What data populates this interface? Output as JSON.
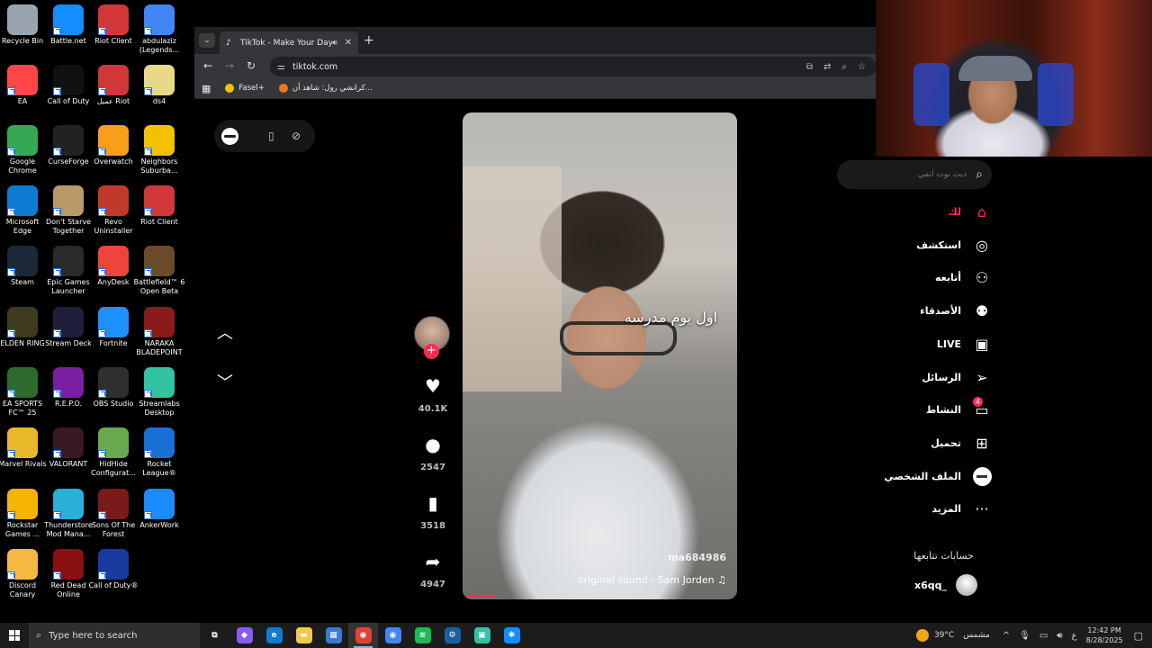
{
  "desktop": {
    "icons": [
      {
        "label": "Recycle Bin",
        "icon": "recycle-bin-icon",
        "color": "#9aa4ae"
      },
      {
        "label": "Battle.net",
        "icon": "battlenet-icon",
        "color": "#148eff"
      },
      {
        "label": "Riot Client",
        "icon": "riot-client-icon",
        "color": "#d13639"
      },
      {
        "label": "abdulaziz (Legends...",
        "icon": "chrome-profile-icon",
        "color": "#4285f4"
      },
      {
        "label": "EA",
        "icon": "ea-icon",
        "color": "#ff4747"
      },
      {
        "label": "Call of Duty",
        "icon": "call-of-duty-icon",
        "color": "#111111"
      },
      {
        "label": "عميل Riot",
        "icon": "riot-client-icon",
        "color": "#d13639"
      },
      {
        "label": "ds4",
        "icon": "folder-file-icon",
        "color": "#e8d98a"
      },
      {
        "label": "Google Chrome",
        "icon": "chrome-icon",
        "color": "#34a853"
      },
      {
        "label": "CurseForge",
        "icon": "curseforge-icon",
        "color": "#222222"
      },
      {
        "label": "Overwatch",
        "icon": "overwatch-icon",
        "color": "#f99e1a"
      },
      {
        "label": "Neighbors Suburba...",
        "icon": "neighbors-icon",
        "color": "#f2c200"
      },
      {
        "label": "Microsoft Edge",
        "icon": "edge-icon",
        "color": "#0c7bd1"
      },
      {
        "label": "Don't Starve Together",
        "icon": "dont-starve-icon",
        "color": "#b89a6a"
      },
      {
        "label": "Revo Uninstaller",
        "icon": "revo-icon",
        "color": "#c0392b"
      },
      {
        "label": "Riot Client",
        "icon": "riot-client-icon",
        "color": "#d13639"
      },
      {
        "label": "Steam",
        "icon": "steam-icon",
        "color": "#1b2838"
      },
      {
        "label": "Epic Games Launcher",
        "icon": "epic-games-icon",
        "color": "#2a2a2a"
      },
      {
        "label": "AnyDesk",
        "icon": "anydesk-icon",
        "color": "#ef443b"
      },
      {
        "label": "Battlefield™ 6 Open Beta",
        "icon": "battlefield-icon",
        "color": "#6b4a2a"
      },
      {
        "label": "ELDEN RING",
        "icon": "elden-ring-icon",
        "color": "#3d3a1e"
      },
      {
        "label": "Stream Deck",
        "icon": "stream-deck-icon",
        "color": "#1f1f3a"
      },
      {
        "label": "Fortnite",
        "icon": "fortnite-icon",
        "color": "#1e90ff"
      },
      {
        "label": "NARAKA BLADEPOINT",
        "icon": "naraka-icon",
        "color": "#8b1a1a"
      },
      {
        "label": "EA SPORTS FC™ 25",
        "icon": "ea-fc-icon",
        "color": "#2d6b2d"
      },
      {
        "label": "R.E.P.O.",
        "icon": "repo-icon",
        "color": "#7a1fa2"
      },
      {
        "label": "OBS Studio",
        "icon": "obs-icon",
        "color": "#302e31"
      },
      {
        "label": "Streamlabs Desktop",
        "icon": "streamlabs-icon",
        "color": "#31c3a2"
      },
      {
        "label": "Marvel Rivals",
        "icon": "marvel-rivals-icon",
        "color": "#e8b82a"
      },
      {
        "label": "VALORANT",
        "icon": "valorant-icon",
        "color": "#3a1a22"
      },
      {
        "label": "HidHide Configurat...",
        "icon": "hidhide-icon",
        "color": "#6aa84f"
      },
      {
        "label": "Rocket League®",
        "icon": "rocket-league-icon",
        "color": "#1a6fd6"
      },
      {
        "label": "Rockstar Games ...",
        "icon": "rockstar-icon",
        "color": "#f4b400"
      },
      {
        "label": "Thunderstore Mod Mana...",
        "icon": "thunderstore-icon",
        "color": "#2ab0d6"
      },
      {
        "label": "Sons Of The Forest",
        "icon": "sons-forest-icon",
        "color": "#7a1a1a"
      },
      {
        "label": "AnkerWork",
        "icon": "ankerwork-icon",
        "color": "#1a8cff"
      },
      {
        "label": "Discord Canary",
        "icon": "discord-canary-icon",
        "color": "#f5b942"
      },
      {
        "label": "Red Dead Online",
        "icon": "red-dead-icon",
        "color": "#8b1010"
      },
      {
        "label": "Call of Duty®",
        "icon": "call-of-duty-icon",
        "color": "#1a3aa0"
      }
    ]
  },
  "browser": {
    "tab_title": "TikTok - Make Your Day",
    "new_tab_glyph": "+",
    "url": "tiktok.com",
    "bookmarks": [
      {
        "label": "Fasel+",
        "color": "#f2c200"
      },
      {
        "label": "كرانشي رول: شاهد أن...",
        "color": "#f47521"
      }
    ]
  },
  "tiktok": {
    "video": {
      "overlay_text": "اول يوم مدرسه",
      "username": "ma684986",
      "sound": "original sound - Sam Jorden ♫",
      "progress": 0.1
    },
    "actions": [
      {
        "name": "like",
        "glyph": "♥",
        "count": "40.1K"
      },
      {
        "name": "comment",
        "glyph": "●",
        "count": "2547"
      },
      {
        "name": "save",
        "glyph": "▮",
        "count": "3518"
      },
      {
        "name": "share",
        "glyph": "➦",
        "count": "4947"
      }
    ],
    "search_placeholder": "ديث نوت انمي",
    "nav": [
      {
        "label": "لك",
        "icon": "home-icon",
        "glyph": "⌂",
        "active": true
      },
      {
        "label": "استكشف",
        "icon": "compass-icon",
        "glyph": "◎"
      },
      {
        "label": "أتابعه",
        "icon": "user-plus-icon",
        "glyph": "⚇"
      },
      {
        "label": "الأصدقاء",
        "icon": "friends-icon",
        "glyph": "⚉"
      },
      {
        "label": "LIVE",
        "icon": "live-tv-icon",
        "glyph": "▣"
      },
      {
        "label": "الرسائل",
        "icon": "send-icon",
        "glyph": "➢"
      },
      {
        "label": "النشاط",
        "icon": "activity-icon",
        "glyph": "▭",
        "badge": "4"
      },
      {
        "label": "تحميل",
        "icon": "upload-icon",
        "glyph": "⊞"
      },
      {
        "label": "الملف الشخصي",
        "icon": "profile-avatar-icon",
        "glyph": ""
      },
      {
        "label": "المزيد",
        "icon": "more-icon",
        "glyph": "···"
      }
    ],
    "following_title": "حسابات تتابعها",
    "following": [
      {
        "name": "x6qq_"
      }
    ]
  },
  "taskbar": {
    "search_placeholder": "Type here to search",
    "apps": [
      {
        "icon": "task-view-icon",
        "glyph": "⧉",
        "color": "#1c1c1c"
      },
      {
        "icon": "copilot-icon",
        "glyph": "◆",
        "color": "#8a5cf6"
      },
      {
        "icon": "edge-icon",
        "glyph": "e",
        "color": "#0c7bd1"
      },
      {
        "icon": "file-explorer-icon",
        "glyph": "▬",
        "color": "#f2c94c"
      },
      {
        "icon": "store-icon",
        "glyph": "▦",
        "color": "#3a7bd5"
      },
      {
        "icon": "chrome-icon",
        "glyph": "◉",
        "color": "#db4437",
        "active": true
      },
      {
        "icon": "chrome-profile-icon",
        "glyph": "◉",
        "color": "#4285f4"
      },
      {
        "icon": "spotify-icon",
        "glyph": "≋",
        "color": "#1db954"
      },
      {
        "icon": "steam-icon",
        "glyph": "⚙",
        "color": "#1b5f9e"
      },
      {
        "icon": "streamlabs-icon",
        "glyph": "▣",
        "color": "#31c3a2"
      },
      {
        "icon": "battlenet-icon",
        "glyph": "✱",
        "color": "#148eff"
      }
    ],
    "weather_temp": "39°C",
    "weather_text": "مشمس",
    "lang": "ع",
    "time": "12:42 PM",
    "date": "8/28/2025"
  }
}
